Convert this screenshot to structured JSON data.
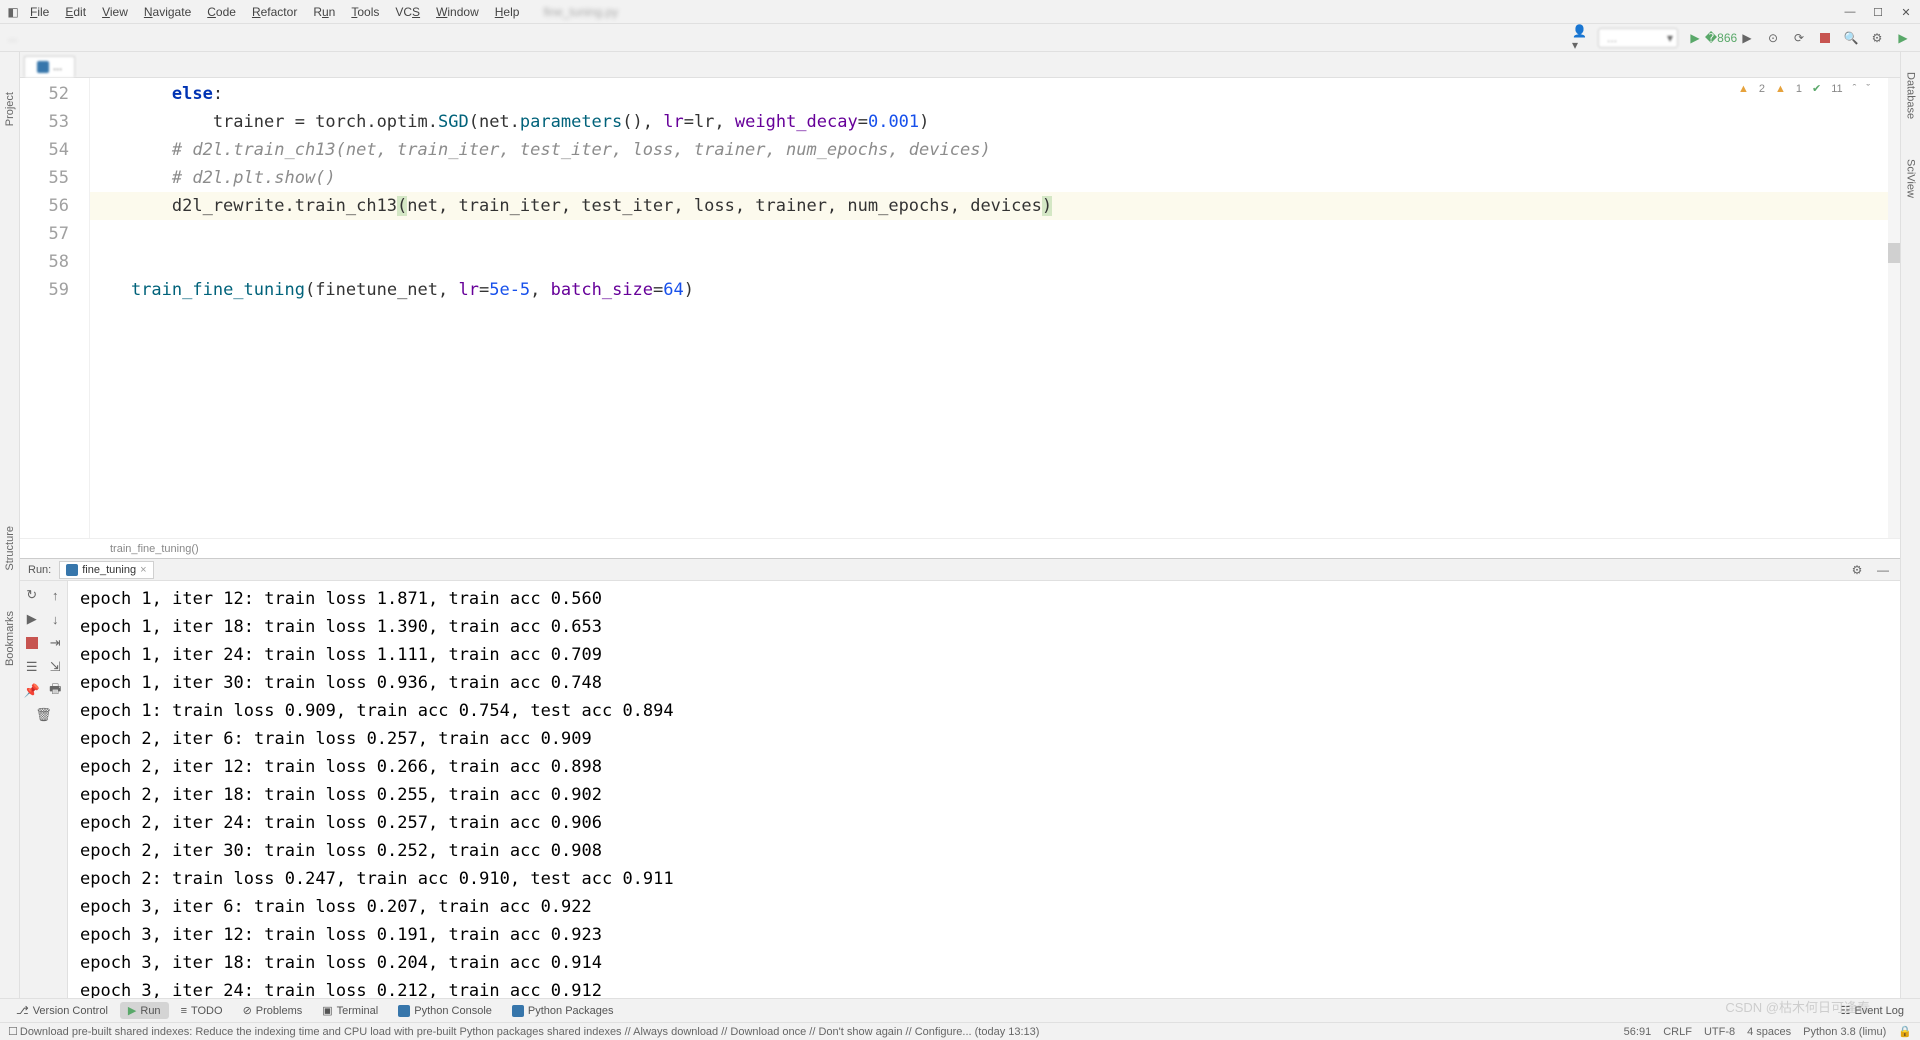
{
  "menu": {
    "items": [
      "File",
      "Edit",
      "View",
      "Navigate",
      "Code",
      "Refactor",
      "Run",
      "Tools",
      "VCS",
      "Window",
      "Help"
    ],
    "title_suffix": "py"
  },
  "navbar": {
    "run_config": "...",
    "breadcrumb": "..."
  },
  "editor": {
    "tab_name": "...",
    "lines": [
      {
        "num": 52,
        "html": "        <span class='kw'>else</span>:"
      },
      {
        "num": 53,
        "html": "            trainer = torch.optim.<span class='fn'>SGD</span>(net.<span class='fn'>parameters</span>(), <span class='param'>lr</span>=lr, <span class='param'>weight_decay</span>=<span class='num'>0.001</span>)"
      },
      {
        "num": 54,
        "html": "        <span class='com'># d2l.train_ch13(net, train_iter, test_iter, loss, trainer, num_epochs, devices)</span>"
      },
      {
        "num": 55,
        "html": "        <span class='com'># d2l.plt.show()</span>"
      },
      {
        "num": 56,
        "hl": true,
        "html": "        d2l_rewrite.train_ch13<span class='bracket-hl'>(</span>net, train_iter, test_iter, loss, trainer, num_epochs, devices<span class='bracket-hl'>)</span>"
      },
      {
        "num": 57,
        "html": ""
      },
      {
        "num": 58,
        "html": ""
      },
      {
        "num": 59,
        "html": "    <span class='fn'>train_fine_tuning</span>(finetune_net, <span class='param'>lr</span>=<span class='num'>5e-5</span>, <span class='param'>batch_size</span>=<span class='num'>64</span>)"
      }
    ],
    "inspections": {
      "warn1": "2",
      "warn2": "1",
      "checks": "11"
    },
    "breadcrumb": "train_fine_tuning()"
  },
  "sidebar": {
    "left": [
      "Project",
      "Bookmarks",
      "Structure"
    ],
    "right": [
      "Database",
      "SciView"
    ]
  },
  "run": {
    "label": "Run:",
    "tab": "fine_tuning",
    "output": [
      "epoch 1, iter 12: train loss 1.871, train acc 0.560",
      "epoch 1, iter 18: train loss 1.390, train acc 0.653",
      "epoch 1, iter 24: train loss 1.111, train acc 0.709",
      "epoch 1, iter 30: train loss 0.936, train acc 0.748",
      "epoch 1: train loss 0.909, train acc 0.754, test acc 0.894",
      "epoch 2, iter 6: train loss 0.257, train acc 0.909",
      "epoch 2, iter 12: train loss 0.266, train acc 0.898",
      "epoch 2, iter 18: train loss 0.255, train acc 0.902",
      "epoch 2, iter 24: train loss 0.257, train acc 0.906",
      "epoch 2, iter 30: train loss 0.252, train acc 0.908",
      "epoch 2: train loss 0.247, train acc 0.910, test acc 0.911",
      "epoch 3, iter 6: train loss 0.207, train acc 0.922",
      "epoch 3, iter 12: train loss 0.191, train acc 0.923",
      "epoch 3, iter 18: train loss 0.204, train acc 0.914",
      "epoch 3, iter 24: train loss 0.212, train acc 0.912"
    ]
  },
  "bottom": {
    "version_control": "Version Control",
    "run": "Run",
    "todo": "TODO",
    "problems": "Problems",
    "terminal": "Terminal",
    "python_console": "Python Console",
    "python_packages": "Python Packages",
    "event_log": "Event Log"
  },
  "status": {
    "message": "Download pre-built shared indexes: Reduce the indexing time and CPU load with pre-built Python packages shared indexes // Always download // Download once // Don't show again // Configure... (today 13:13)",
    "cursor": "56:91",
    "line_sep": "CRLF",
    "encoding": "UTF-8",
    "indent": "4 spaces",
    "interpreter": "Python 3.8 (limu)"
  },
  "watermark": "CSDN @枯木何日可逢春"
}
